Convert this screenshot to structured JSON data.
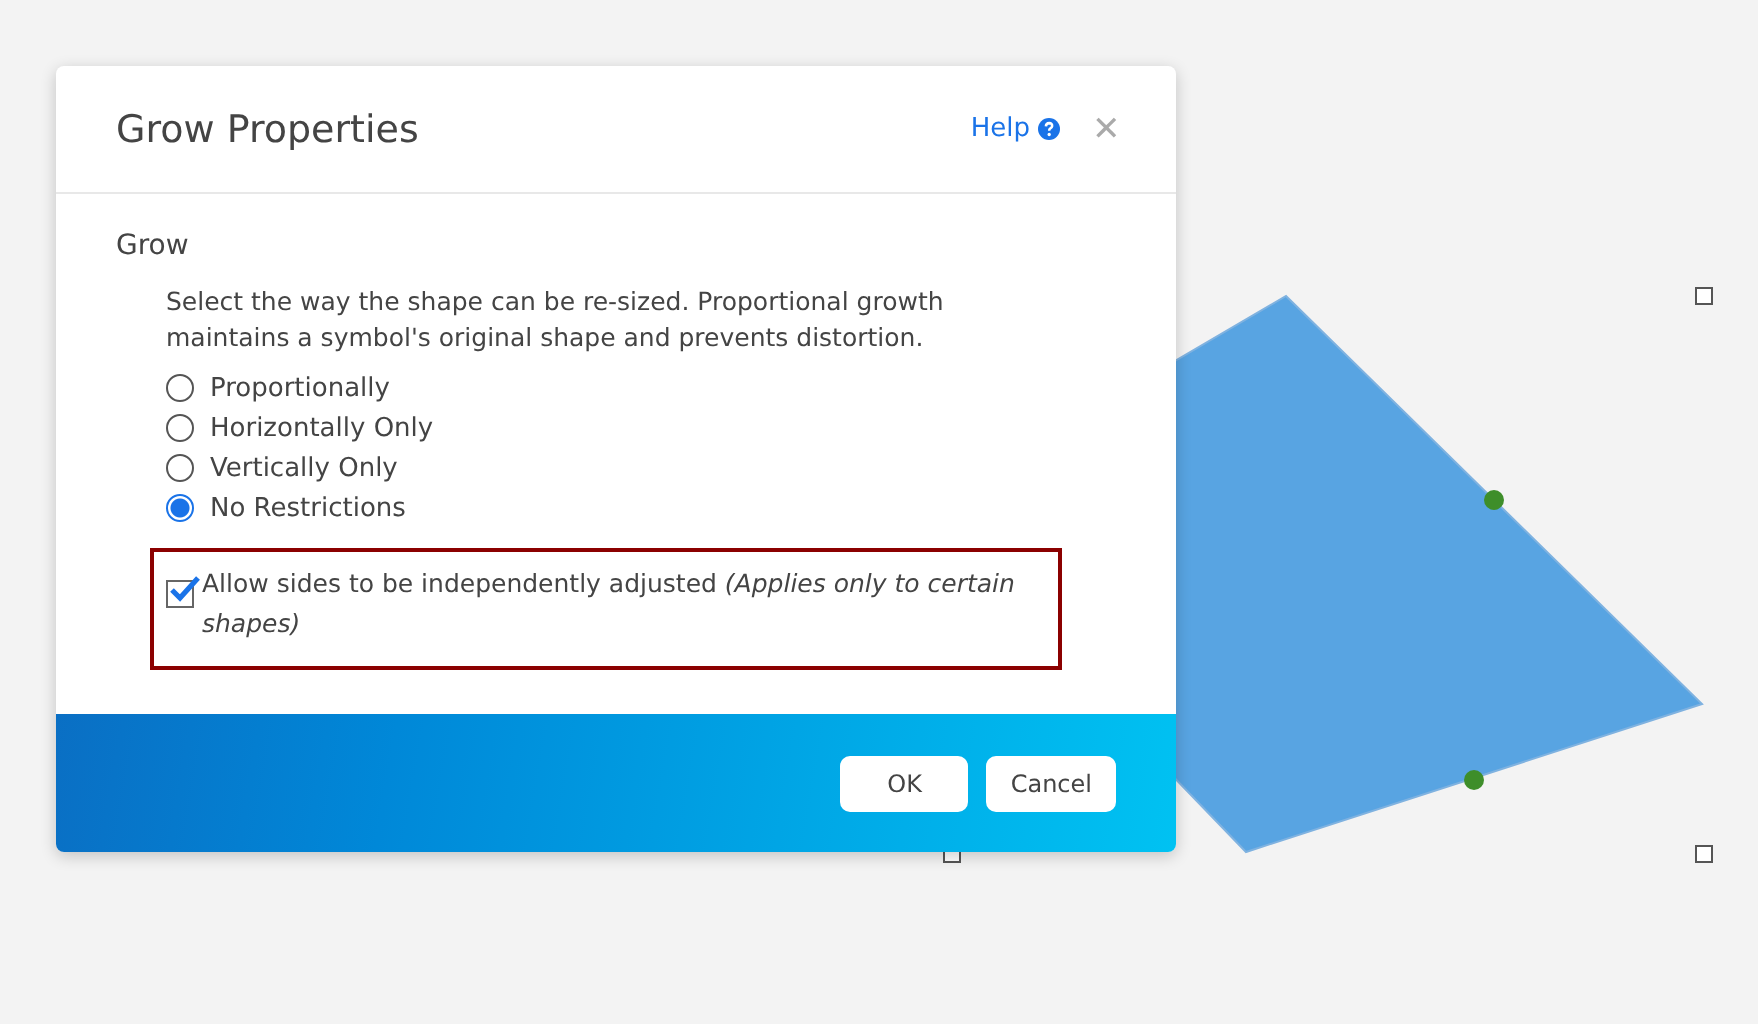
{
  "dialog": {
    "title": "Grow Properties",
    "help": "Help",
    "close": "✕",
    "section": "Grow",
    "description": "Select the way the shape can be re-sized. Proportional growth maintains a symbol's original shape and prevents distortion.",
    "options": [
      {
        "label": "Proportionally",
        "selected": false
      },
      {
        "label": "Horizontally Only",
        "selected": false
      },
      {
        "label": "Vertically Only",
        "selected": false
      },
      {
        "label": "No Restrictions",
        "selected": true
      }
    ],
    "checkbox": {
      "label": "Allow sides to be independently adjusted *(Applies only to certain shapes)*",
      "checked": true
    },
    "buttons": [
      "OK",
      "Cancel"
    ]
  }
}
